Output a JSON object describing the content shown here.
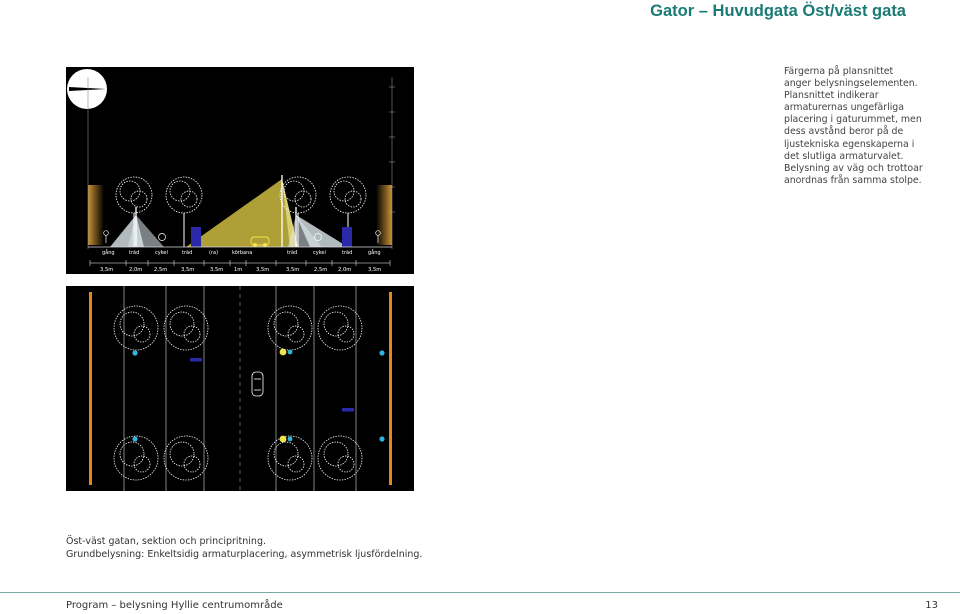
{
  "header": {
    "title": "Gator – Huvudgata Öst/väst gata"
  },
  "description": {
    "lines": [
      "Färgerna på plansnittet",
      "anger belysningselementen.",
      "Plansnittet indikerar",
      "armaturernas ungefärliga",
      "placering i gaturummet, men",
      "dess avstånd beror på de",
      "ljustekniska egenskaperna i",
      "det slutliga armaturvalet.",
      "Belysning av väg och trottoar",
      "anordnas från samma stolpe."
    ]
  },
  "section": {
    "zones": [
      "gång",
      "träd",
      "cykel",
      "träd",
      "(ra)",
      "körbana",
      "träd",
      "cykel",
      "träd",
      "gång"
    ],
    "dimensions": [
      "3,5m",
      "2,0m",
      "2,5m",
      "3,5m",
      "3,5m",
      "1m",
      "3,5m",
      "3,5m",
      "2,5m",
      "2,0m",
      "3,5m"
    ]
  },
  "caption": {
    "line1": "Öst-väst gatan, sektion och principritning.",
    "line2": "Grundbelysning: Enkeltsidig armaturplacering, asymmetrisk ljusfördelning."
  },
  "footer": {
    "left": "Program – belysning Hyllie centrumområde",
    "page": "13"
  },
  "colors": {
    "title": "#1a7a76",
    "road_light": "#f3e24a",
    "walk_light": "#2fb3e0",
    "edge_light": "#e08a1e",
    "bench": "#2a2aa8"
  },
  "icons": {
    "compass": "north-arrow-icon",
    "car": "car-icon",
    "tree": "tree-icon"
  }
}
